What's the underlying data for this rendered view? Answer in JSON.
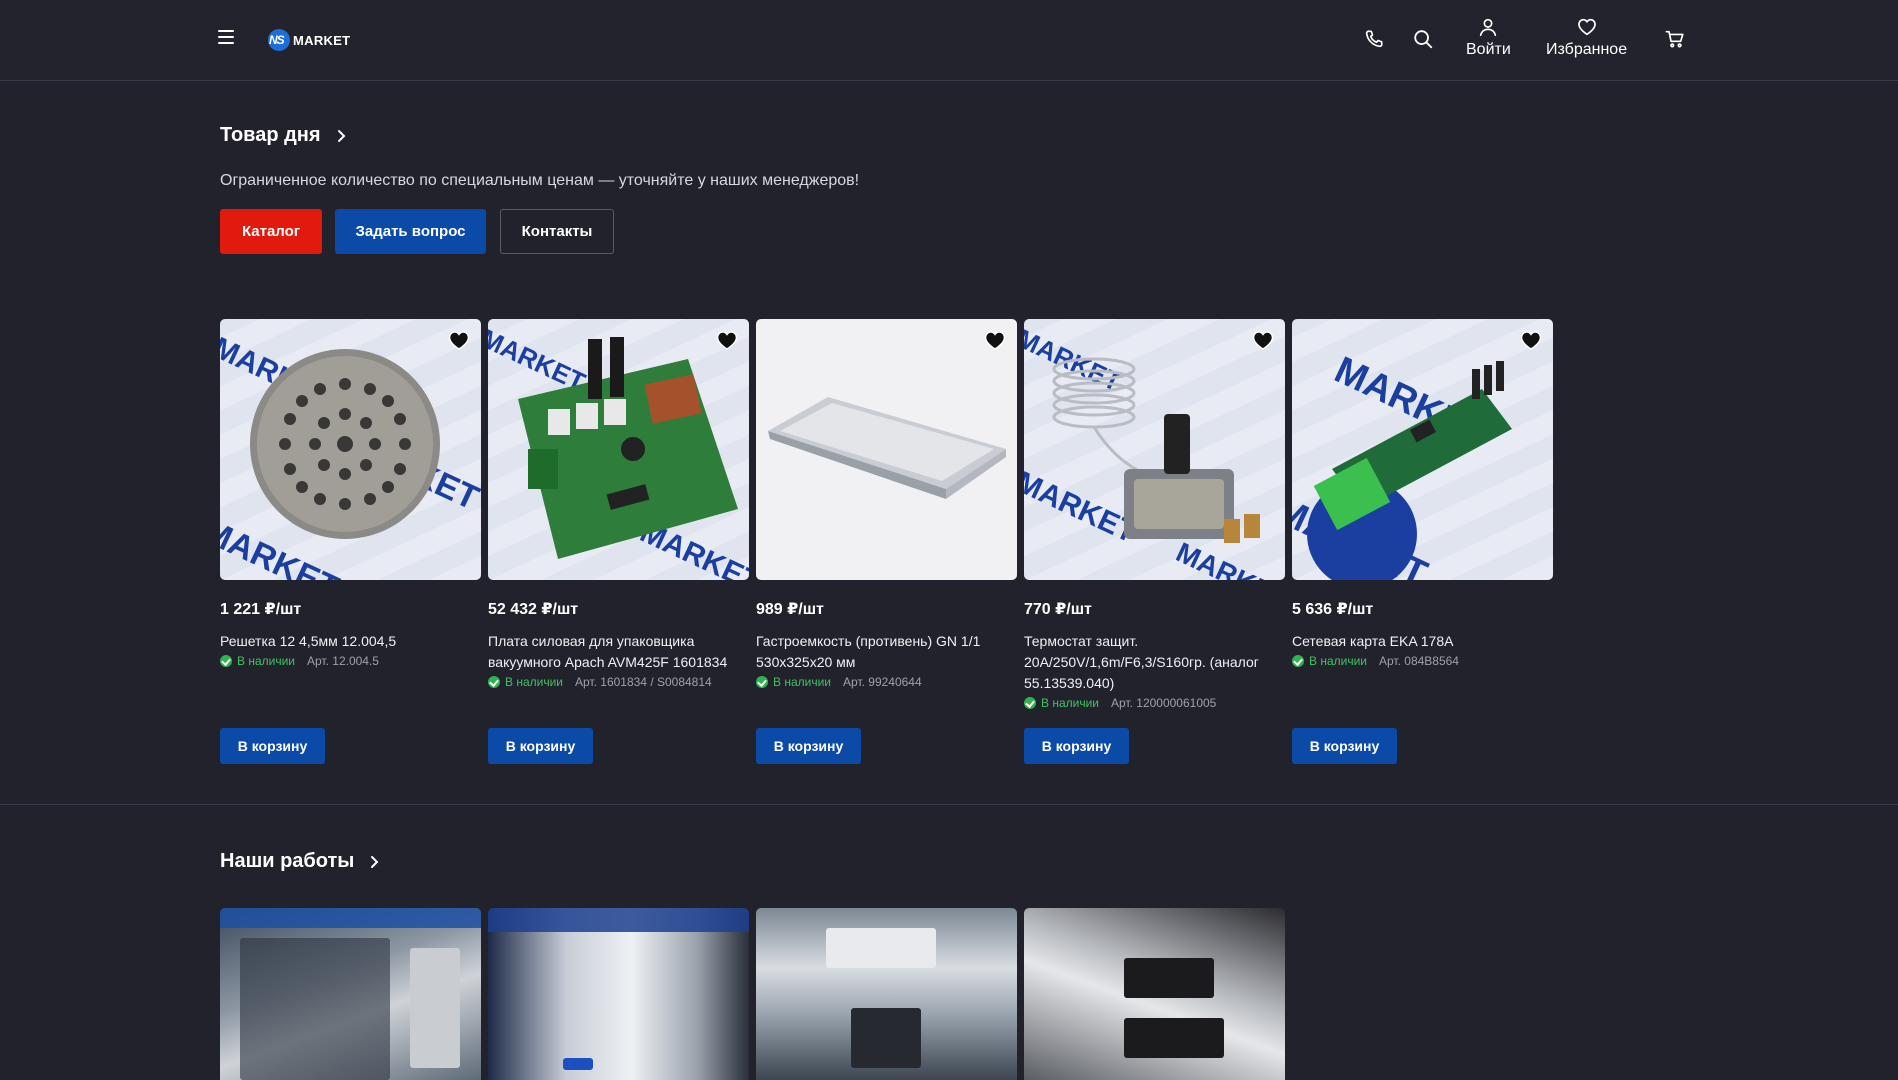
{
  "header": {
    "logo_text": "MARKET",
    "login_label": "Войти",
    "favorites_label": "Избранное"
  },
  "promo": {
    "title": "Товар дня",
    "subtitle": "Ограниченное количество по специальным ценам — уточняйте у наших менеджеров!",
    "catalog_button": "Каталог",
    "ask_button": "Задать вопрос",
    "contacts_button": "Контакты"
  },
  "products": [
    {
      "price": "1 221 ₽/шт",
      "name": "Решетка 12 4,5мм 12.004,5",
      "stock": "В наличии",
      "article": "Арт. 12.004.5",
      "cart": "В корзину"
    },
    {
      "price": "52 432 ₽/шт",
      "name": "Плата силовая для упаковщика вакуумного Apach AVM425F 1601834",
      "stock": "В наличии",
      "article": "Арт. 1601834 / S0084814",
      "cart": "В корзину"
    },
    {
      "price": "989 ₽/шт",
      "name": "Гастроемкость (противень) GN 1/1 530x325x20 мм",
      "stock": "В наличии",
      "article": "Арт. 99240644",
      "cart": "В корзину"
    },
    {
      "price": "770 ₽/шт",
      "name": "Термостат защит. 20A/250V/1,6m/F6,3/S160гр. (аналог 55.13539.040)",
      "stock": "В наличии",
      "article": "Арт. 120000061005",
      "cart": "В корзину"
    },
    {
      "price": "5 636 ₽/шт",
      "name": "Сетевая карта EKA 178A",
      "stock": "В наличии",
      "article": "Арт. 084B8564",
      "cart": "В корзину"
    }
  ],
  "works": {
    "title": "Наши работы"
  },
  "colors": {
    "background": "#22222c",
    "accent_red": "#e1190e",
    "accent_blue": "#0c4aa8",
    "stock_green": "#3fc35e"
  }
}
